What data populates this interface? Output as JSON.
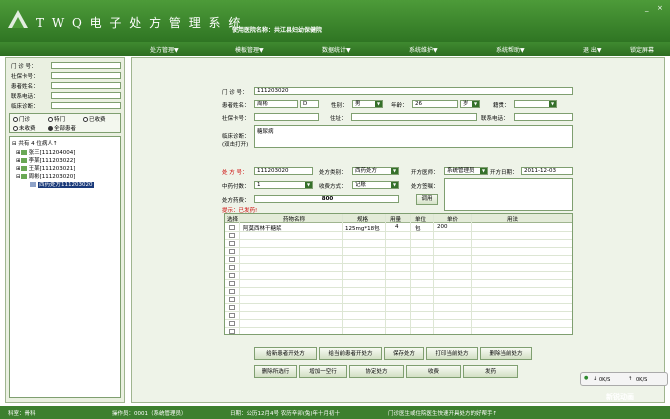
{
  "app": {
    "title": "T W Q 电 子 处 方 管 理 系 统",
    "hospital": "使用医院名称：共江县妇幼保健院",
    "win_min": "_",
    "win_close": "×"
  },
  "menu": [
    "处方管理▼",
    "模板管理▼",
    "数据统计▼",
    "系统维护▼",
    "系统帮助▼",
    "退 出▼",
    "锁定屏幕"
  ],
  "query": {
    "fields": [
      {
        "label": "门 诊 号：",
        "value": ""
      },
      {
        "label": "社保卡号：",
        "value": ""
      },
      {
        "label": "患者姓名：",
        "value": ""
      },
      {
        "label": "联系电话：",
        "value": ""
      },
      {
        "label": "临床诊断：",
        "value": ""
      }
    ],
    "radios": [
      {
        "label": "门诊",
        "on": false
      },
      {
        "label": "特门",
        "on": false
      },
      {
        "label": "已收费",
        "on": false
      },
      {
        "label": "未收费",
        "on": false
      },
      {
        "label": "全部患者",
        "on": true
      }
    ]
  },
  "tree": [
    {
      "text": "共有 4 位病人↑",
      "prefix": "⊟",
      "sel": false
    },
    {
      "text": "张三[111204004]",
      "prefix": "⊞",
      "sel": false
    },
    {
      "text": "李某[111203022]",
      "prefix": "⊞",
      "sel": false
    },
    {
      "text": "王某[111203021]",
      "prefix": "⊞",
      "sel": false
    },
    {
      "text": "周彬[111203020]",
      "prefix": "⊟",
      "sel": false
    },
    {
      "text": "西药处方111203020",
      "prefix": "",
      "sel": true
    }
  ],
  "patient": {
    "outpatient_label": "门 诊 号：",
    "outpatient_no": "111203020",
    "name_label": "患者姓名：",
    "name": "周彬",
    "id": "D",
    "gender_label": "性别：",
    "gender": "男",
    "age_label": "年龄：",
    "age": "26",
    "age_unit": "岁",
    "nation_label": "籍贯：",
    "nation": "",
    "insurance_label": "社保卡号：",
    "insurance": "",
    "address_label": "住址：",
    "address": "",
    "phone_label": "联系电话：",
    "phone": "",
    "diagnosis_label": "临床诊断：",
    "diagnosis_hint": "(双击打开)",
    "diagnosis": "糖尿病"
  },
  "rx": {
    "no_label": "处 方 号：",
    "no": "111203020",
    "type_label": "处方类别：",
    "type": "西药处方",
    "doctor_label": "开方医师：",
    "doctor": "系统管理员",
    "date_label": "开方日期：",
    "date": "2011-12-03",
    "doses_label": "中药付数：",
    "doses": "1",
    "pay_label": "收费方式：",
    "pay": "记账",
    "note_label": "处方签嘱：",
    "note": "",
    "fee_label": "处方药费：",
    "fee": "800",
    "call_btn": "调用",
    "hint": "提示：已发药!"
  },
  "grid": {
    "headers": [
      "选择",
      "药物名称",
      "规格",
      "用量",
      "单位",
      "单价",
      "用法"
    ],
    "rows": [
      {
        "name": "阿莫西林干糖浆",
        "spec": "125mg*18包",
        "dose": "4",
        "unit": "包",
        "price": "200",
        "usage": ""
      },
      {
        "name": "",
        "spec": "",
        "dose": "",
        "unit": "",
        "price": "",
        "usage": ""
      },
      {
        "name": "",
        "spec": "",
        "dose": "",
        "unit": "",
        "price": "",
        "usage": ""
      },
      {
        "name": "",
        "spec": "",
        "dose": "",
        "unit": "",
        "price": "",
        "usage": ""
      },
      {
        "name": "",
        "spec": "",
        "dose": "",
        "unit": "",
        "price": "",
        "usage": ""
      },
      {
        "name": "",
        "spec": "",
        "dose": "",
        "unit": "",
        "price": "",
        "usage": ""
      },
      {
        "name": "",
        "spec": "",
        "dose": "",
        "unit": "",
        "price": "",
        "usage": ""
      },
      {
        "name": "",
        "spec": "",
        "dose": "",
        "unit": "",
        "price": "",
        "usage": ""
      },
      {
        "name": "",
        "spec": "",
        "dose": "",
        "unit": "",
        "price": "",
        "usage": ""
      },
      {
        "name": "",
        "spec": "",
        "dose": "",
        "unit": "",
        "price": "",
        "usage": ""
      },
      {
        "name": "",
        "spec": "",
        "dose": "",
        "unit": "",
        "price": "",
        "usage": ""
      },
      {
        "name": "",
        "spec": "",
        "dose": "",
        "unit": "",
        "price": "",
        "usage": ""
      },
      {
        "name": "",
        "spec": "",
        "dose": "",
        "unit": "",
        "price": "",
        "usage": ""
      },
      {
        "name": "",
        "spec": "",
        "dose": "",
        "unit": "",
        "price": "",
        "usage": ""
      }
    ]
  },
  "actions": {
    "row1": [
      "给新患者开处方",
      "给当前患者开处方",
      "保存处方",
      "打印当前处方",
      "删除当前处方"
    ],
    "row2": [
      "删除所选行",
      "增加一空行",
      "协定处方",
      "收费",
      "发药"
    ]
  },
  "status": {
    "unit": "科室：骨科",
    "operator": "操作员：0001（系统管理员）",
    "date": "日期：公历12月4号  农历辛卯(兔)年十月初十",
    "tip": "门诊医生或住院医生快速开具处方的好帮手↑"
  },
  "ime": {
    "speed1": "0K/S",
    "speed2": "0K/S"
  },
  "watermark": "新锐动画",
  "colors": {
    "brand": "#3d7f2f",
    "accent": "#c00000"
  }
}
